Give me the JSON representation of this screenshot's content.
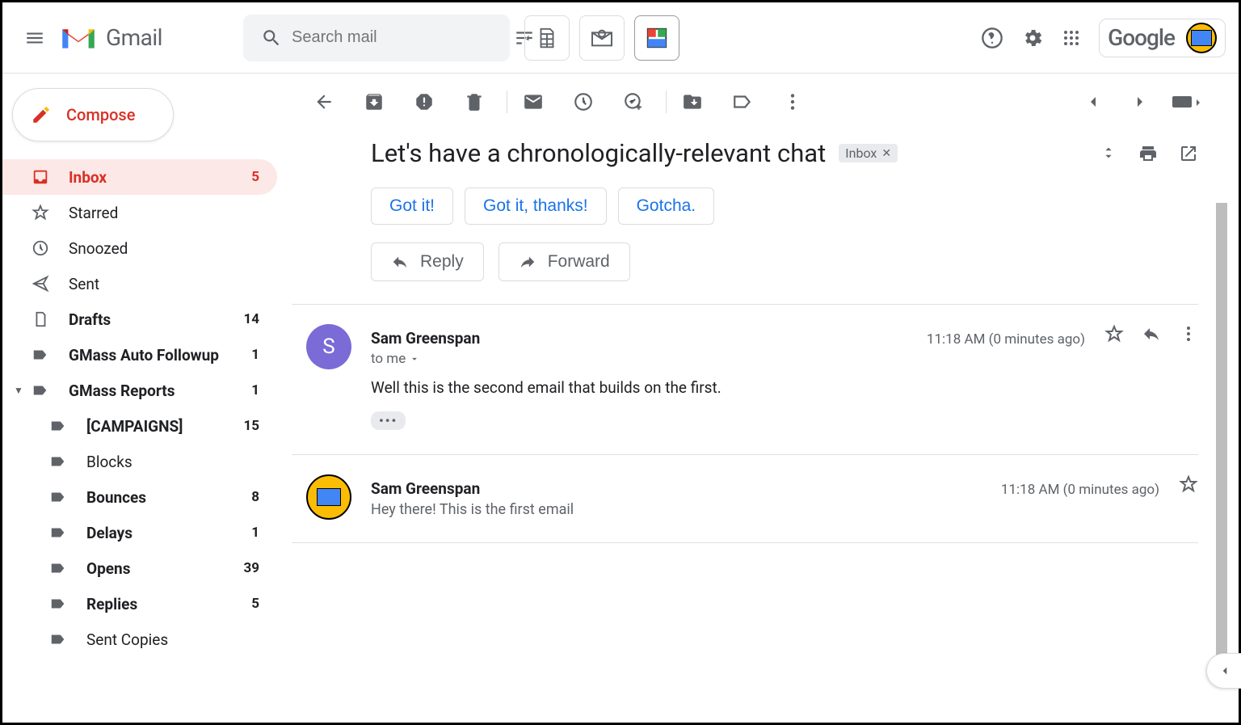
{
  "header": {
    "app_name": "Gmail",
    "search_placeholder": "Search mail",
    "google_brand": "Google"
  },
  "compose": {
    "label": "Compose"
  },
  "sidebar": {
    "items": [
      {
        "label": "Inbox",
        "count": "5",
        "icon": "inbox",
        "active": true,
        "bold": true
      },
      {
        "label": "Starred",
        "count": "",
        "icon": "star",
        "active": false,
        "bold": false
      },
      {
        "label": "Snoozed",
        "count": "",
        "icon": "clock",
        "active": false,
        "bold": false
      },
      {
        "label": "Sent",
        "count": "",
        "icon": "send",
        "active": false,
        "bold": false
      },
      {
        "label": "Drafts",
        "count": "14",
        "icon": "file",
        "active": false,
        "bold": true
      },
      {
        "label": "GMass Auto Followup",
        "count": "1",
        "icon": "label",
        "active": false,
        "bold": true
      },
      {
        "label": "GMass Reports",
        "count": "1",
        "icon": "label",
        "active": false,
        "bold": true,
        "caret": true
      }
    ],
    "sub": [
      {
        "label": "[CAMPAIGNS]",
        "count": "15",
        "bold": true
      },
      {
        "label": "Blocks",
        "count": "",
        "bold": false
      },
      {
        "label": "Bounces",
        "count": "8",
        "bold": true
      },
      {
        "label": "Delays",
        "count": "1",
        "bold": true
      },
      {
        "label": "Opens",
        "count": "39",
        "bold": true
      },
      {
        "label": "Replies",
        "count": "5",
        "bold": true
      },
      {
        "label": "Sent Copies",
        "count": "",
        "bold": false
      }
    ]
  },
  "thread": {
    "subject": "Let's have a chronologically-relevant chat",
    "chip": "Inbox",
    "smart": [
      "Got it!",
      "Got it, thanks!",
      "Gotcha."
    ],
    "reply_label": "Reply",
    "forward_label": "Forward"
  },
  "messages": [
    {
      "sender": "Sam Greenspan",
      "to": "to me",
      "time": "11:18 AM (0 minutes ago)",
      "body": "Well this is the second email that builds on the first.",
      "avatar_letter": "S",
      "avatar_color": "#7b6bd6",
      "expanded": true,
      "trimmed": "•••"
    },
    {
      "sender": "Sam Greenspan",
      "time": "11:18 AM (0 minutes ago)",
      "snippet": "Hey there! This is the first email",
      "expanded": false
    }
  ]
}
